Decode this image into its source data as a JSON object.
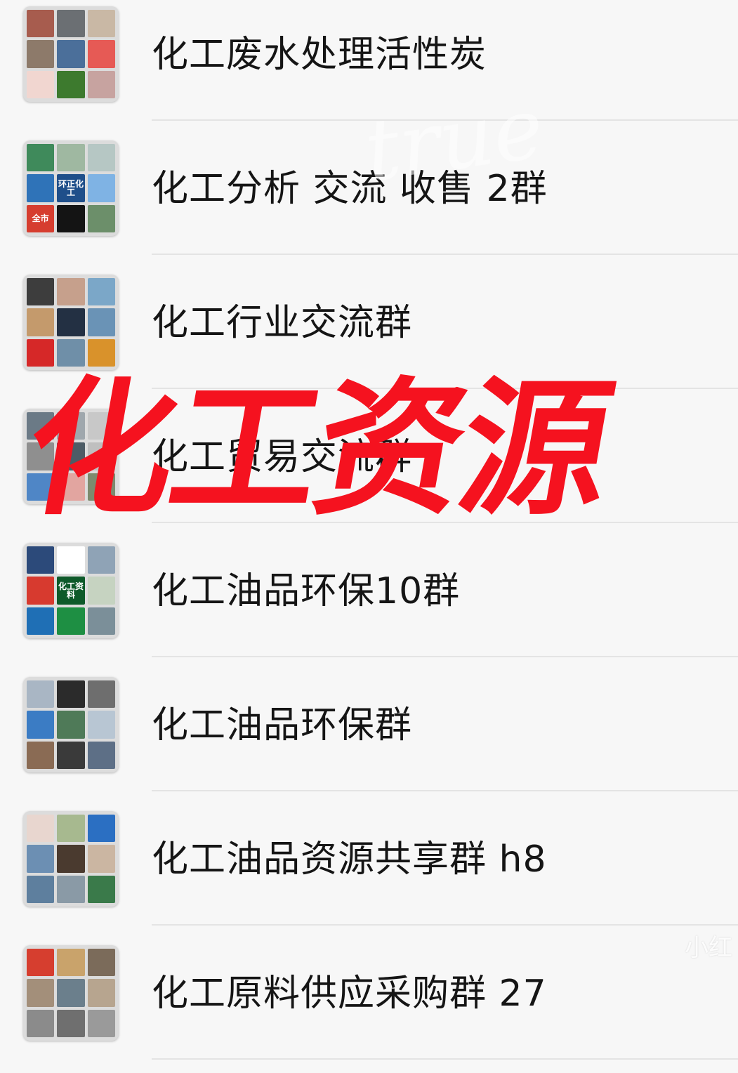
{
  "groups": [
    {
      "name": "化工废水处理活性炭",
      "tiles": [
        "#a75c4e",
        "#6b6f73",
        "#c9b8a5",
        "#8d7a6a",
        "#4b6f9a",
        "#e65a55",
        "#f1d6d0",
        "#3d7a2e",
        "#c7a3a0"
      ]
    },
    {
      "name": "化工分析 交流 收售 2群",
      "tiles": [
        "#3f8a5b",
        "#9fb8a1",
        "#b6c7c4",
        "#2f73b8",
        "#1f4f8a",
        "#7fb3e4",
        "#d63d2f",
        "#141414",
        "#6c8f6a"
      ],
      "tile_labels": {
        "4": "环正化工",
        "6": "全市"
      }
    },
    {
      "name": "化工行业交流群",
      "tiles": [
        "#3d3d3d",
        "#c6a08c",
        "#7ba7c8",
        "#c49a6c",
        "#233043",
        "#6a93b6",
        "#d62828",
        "#6f8fa8",
        "#d9922b"
      ]
    },
    {
      "name": "化工贸易交流群",
      "tiles": [
        "#6b7a86",
        "#9fa7ad",
        "#c8c8c8",
        "#8f8f8f",
        "#4d5c66",
        "#bfbfbf",
        "#4f86c6",
        "#e2a5a0",
        "#7d8a6e"
      ]
    },
    {
      "name": "化工油品环保10群",
      "tiles": [
        "#2c4a7a",
        "#ffffff",
        "#8fa3b6",
        "#d73a2f",
        "#0e5a2a",
        "#c6d3c1",
        "#1f6fb5",
        "#1e8f43",
        "#7b8f99"
      ],
      "tile_labels": {
        "4": "化工资料"
      }
    },
    {
      "name": "化工油品环保群",
      "tiles": [
        "#a9b6c4",
        "#2b2b2b",
        "#6e6e6e",
        "#3b7cc4",
        "#4f7a58",
        "#b8c6d3",
        "#8a6b54",
        "#3a3a3a",
        "#5d6f86"
      ]
    },
    {
      "name": "化工油品资源共享群 h8",
      "tiles": [
        "#e8d6cf",
        "#a7b98f",
        "#2b6fc2",
        "#6c8fb3",
        "#4a3a2f",
        "#cbb6a2",
        "#5e7f9e",
        "#8a9aa6",
        "#3a7a4a"
      ]
    },
    {
      "name": "化工原料供应采购群 27",
      "tiles": [
        "#d63e2f",
        "#c9a36b",
        "#7b6b5a",
        "#a38f7a",
        "#6b7f8c",
        "#b7a58f",
        "#8b8b8b",
        "#6f6f6f",
        "#9a9a9a"
      ]
    }
  ],
  "overlay": {
    "title": "化工资源"
  },
  "watermark": {
    "script": "true",
    "brand": "小红"
  }
}
